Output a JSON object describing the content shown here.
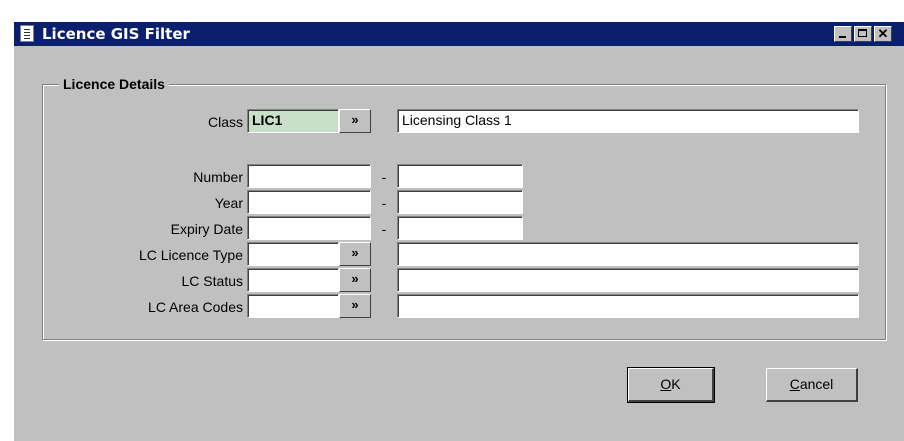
{
  "window": {
    "title": "Licence GIS Filter",
    "icon": "document-icon",
    "titlebar_color": "#0a1f6e",
    "controls": [
      "minimize",
      "maximize",
      "close"
    ]
  },
  "group": {
    "legend": "Licence Details"
  },
  "fields": {
    "class": {
      "label": "Class",
      "value": "LIC1",
      "description": "Licensing Class 1",
      "lookup_label": "»"
    },
    "number": {
      "label": "Number",
      "from": "",
      "to": "",
      "separator": "-"
    },
    "year": {
      "label": "Year",
      "from": "",
      "to": "",
      "separator": "-"
    },
    "expiry_date": {
      "label": "Expiry Date",
      "from": "",
      "to": "",
      "separator": "-"
    },
    "lc_licence_type": {
      "label": "LC Licence Type",
      "value": "",
      "description": "",
      "lookup_label": "»"
    },
    "lc_status": {
      "label": "LC Status",
      "value": "",
      "description": "",
      "lookup_label": "»"
    },
    "lc_area_codes": {
      "label": "LC Area Codes",
      "value": "",
      "description": "",
      "lookup_label": "»"
    }
  },
  "buttons": {
    "ok_underlined": "O",
    "ok_rest": "K",
    "cancel_underlined": "C",
    "cancel_rest": "ancel"
  },
  "colors": {
    "dialog_background": "#c0c0c0",
    "class_field_highlight": "#c8e0c8"
  }
}
